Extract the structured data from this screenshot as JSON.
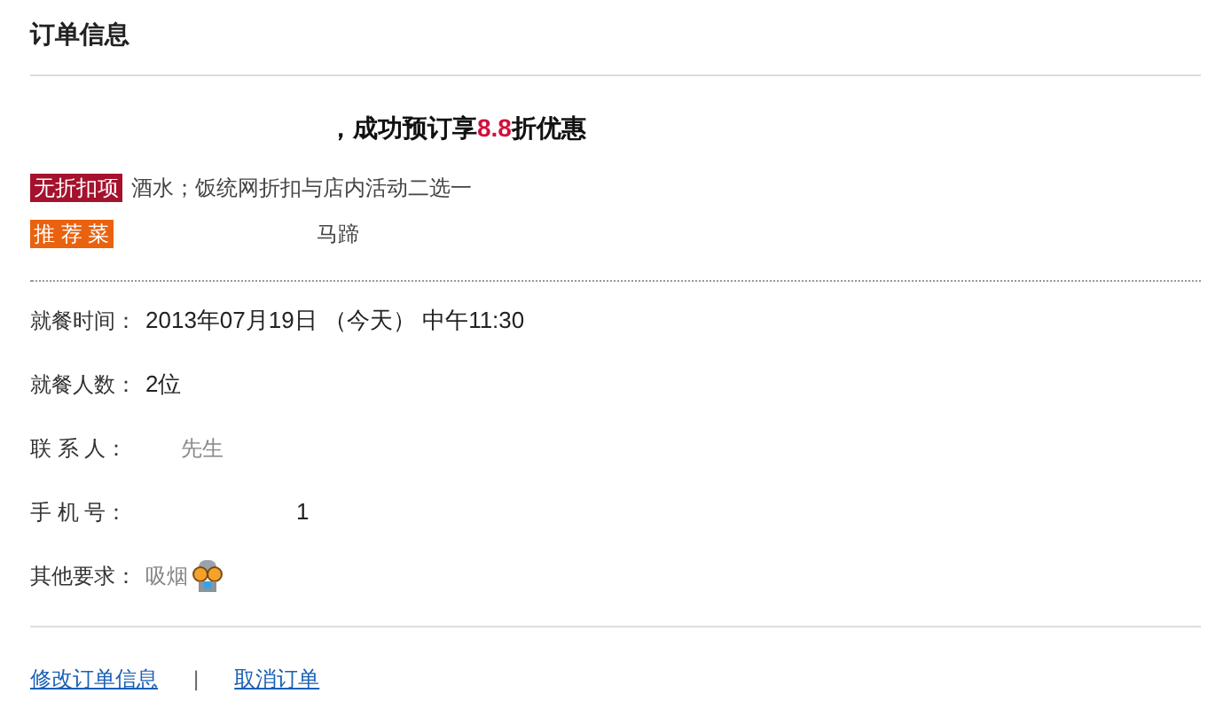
{
  "title": "订单信息",
  "headline": {
    "text": "，成功预订享",
    "discount": "8.8",
    "suffix": "折优惠"
  },
  "tags": [
    {
      "badge": "无折扣项",
      "color": "#a5122d",
      "text": "酒水；饭统网折扣与店内活动二选一"
    },
    {
      "badge": "推 荐 菜",
      "color": "#e8620f",
      "text": "马蹄"
    }
  ],
  "fields": [
    {
      "label": "就餐时间：",
      "value": "2013年07月19日 （今天） 中午11:30",
      "muted": false
    },
    {
      "label": "就餐人数：",
      "value": "2位",
      "muted": false
    },
    {
      "label": "联 系 人：",
      "value": "先生",
      "muted": true
    },
    {
      "label": "手 机 号：",
      "value": "1",
      "muted": false
    },
    {
      "label": "其他要求：",
      "value": "吸烟",
      "muted": true,
      "emoticon": true
    }
  ],
  "links": [
    "修改订单信息",
    "取消订单"
  ],
  "separator": "|"
}
